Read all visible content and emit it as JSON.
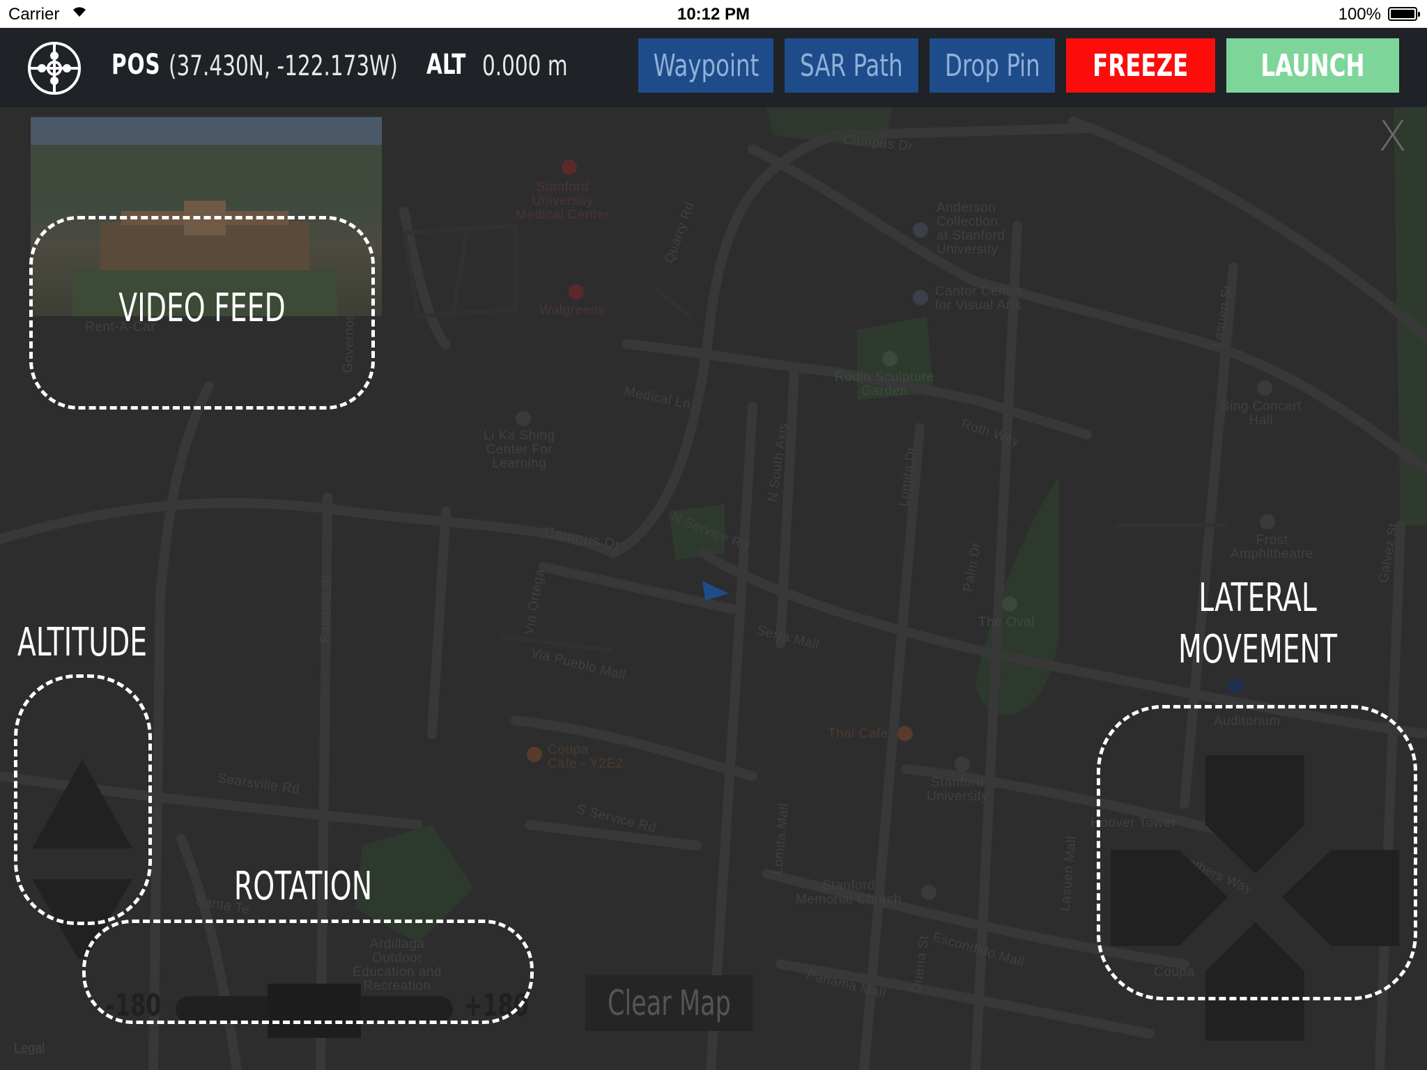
{
  "status_bar": {
    "carrier": "Carrier",
    "time": "10:12 PM",
    "battery": "100%"
  },
  "toolbar": {
    "pos_label": "POS",
    "pos_value": "(37.430N, -122.173W)",
    "alt_label": "ALT",
    "alt_value": "0.000 m",
    "buttons": {
      "waypoint": "Waypoint",
      "sar_path": "SAR Path",
      "drop_pin": "Drop Pin",
      "freeze": "FREEZE",
      "launch": "LAUNCH"
    }
  },
  "colors": {
    "toolbar_bg": "#1f2226",
    "blue_button": "#1e4c8a",
    "freeze": "#fc0d0c",
    "launch": "#7ed59a",
    "map_bg": "#2d2d2d"
  },
  "overlay": {
    "close": "X",
    "video_feed": "VIDEO FEED",
    "altitude": "ALTITUDE",
    "rotation": "ROTATION",
    "lateral_movement_line1": "LATERAL",
    "lateral_movement_line2": "MOVEMENT",
    "rotation_min": "-180",
    "rotation_max": "+180",
    "clear_map": "Clear Map",
    "legal": "Legal"
  },
  "map": {
    "streets": {
      "campus_dr_top": "Campus Dr",
      "campus_dr_mid": "Campus Dr",
      "quarry_rd": "Quarry Rd",
      "medical_ln": "Medical Ln",
      "n_service_rd": "N Service Rd",
      "n_south_axis": "N South Axis",
      "lomita_dr": "Lomita Dr",
      "roth_way": "Roth Way",
      "palm_dr": "Palm Dr",
      "lasuen_st": "Lasuen St",
      "galvez_st": "Galvez St",
      "serra_mall": "Serra Mall",
      "via_ortega": "Via Ortega",
      "via_pueblo_mall": "Via Pueblo Mall",
      "panama_st": "Panama St",
      "governor": "Governor",
      "searsville_rd": "Searsville Rd",
      "s_service_rd": "S Service Rd",
      "lomita_mall": "Lomita Mall",
      "lasuen_mall": "Lasuen Mall",
      "escondido_mall": "Escondido Mall",
      "panama_mall": "Panama Mall",
      "duena_st": "Duena St",
      "santa_teresa": "Santa Te",
      "santa_teresa_st": "Santa Te Sa St",
      "crothers_way": "Crothers Way",
      "hoover_tower": "Hoover Tower"
    },
    "pois": {
      "stanford_medical": "Stanford\nUniversity\nMedical Center",
      "walgreens": "Walgreens",
      "anderson": "Anderson\nCollection\nat Stanford\nUniversity",
      "cantor": "Cantor Center\nfor Visual Arts",
      "rodin": "Rodin Sculpture\nGarden",
      "li_ka_shing": "Li Ka Shing\nCenter For\nLearning",
      "bing": "Bing Concert\nHall",
      "frost": "Frost\nAmphitheatre",
      "the_oval": "The Oval",
      "thai_cafe": "Thai Cafe",
      "coupa_y2e2": "Coupa\nCafe - Y2E2",
      "stanford_university": "Stanford\nUniversity",
      "memorial_church": "Stanford\nMemorial Church",
      "ardillaga": "Ardillaga\nOutdoor\nEducation and\nRecreation",
      "auditorium": "Auditorium",
      "coupa": "Coupa",
      "rent_a_car": "Rent-A-Car"
    }
  }
}
